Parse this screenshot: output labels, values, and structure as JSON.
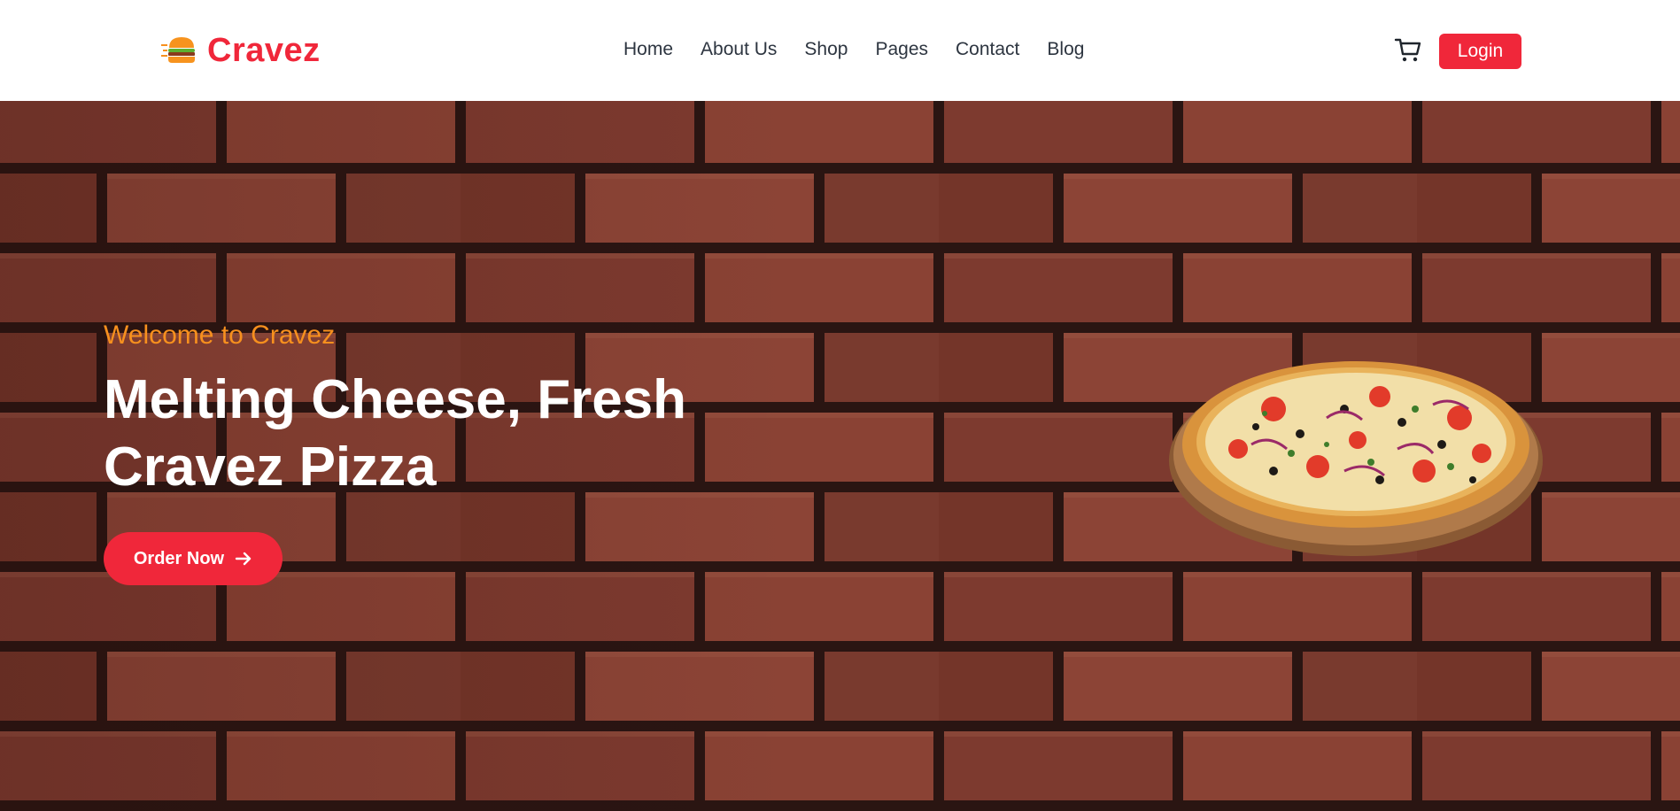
{
  "brand": {
    "name": "Cravez",
    "icon": "burger-icon",
    "color": "#f0273a"
  },
  "nav": {
    "items": [
      {
        "label": "Home"
      },
      {
        "label": "About Us"
      },
      {
        "label": "Shop"
      },
      {
        "label": "Pages"
      },
      {
        "label": "Contact"
      },
      {
        "label": "Blog"
      }
    ]
  },
  "header_actions": {
    "cart_icon": "cart-icon",
    "login_label": "Login"
  },
  "hero": {
    "eyebrow": "Welcome to Cravez",
    "headline": "Melting Cheese, Fresh Cravez Pizza",
    "cta_label": "Order Now",
    "cta_icon": "arrow-right-icon",
    "image": "pizza-image",
    "background": "brick-wall-background"
  },
  "colors": {
    "accent": "#f0273a",
    "eyebrow": "#f7901e",
    "nav_text": "#2d3540",
    "brick": "#7d3a2f",
    "mortar": "#2a1512"
  }
}
